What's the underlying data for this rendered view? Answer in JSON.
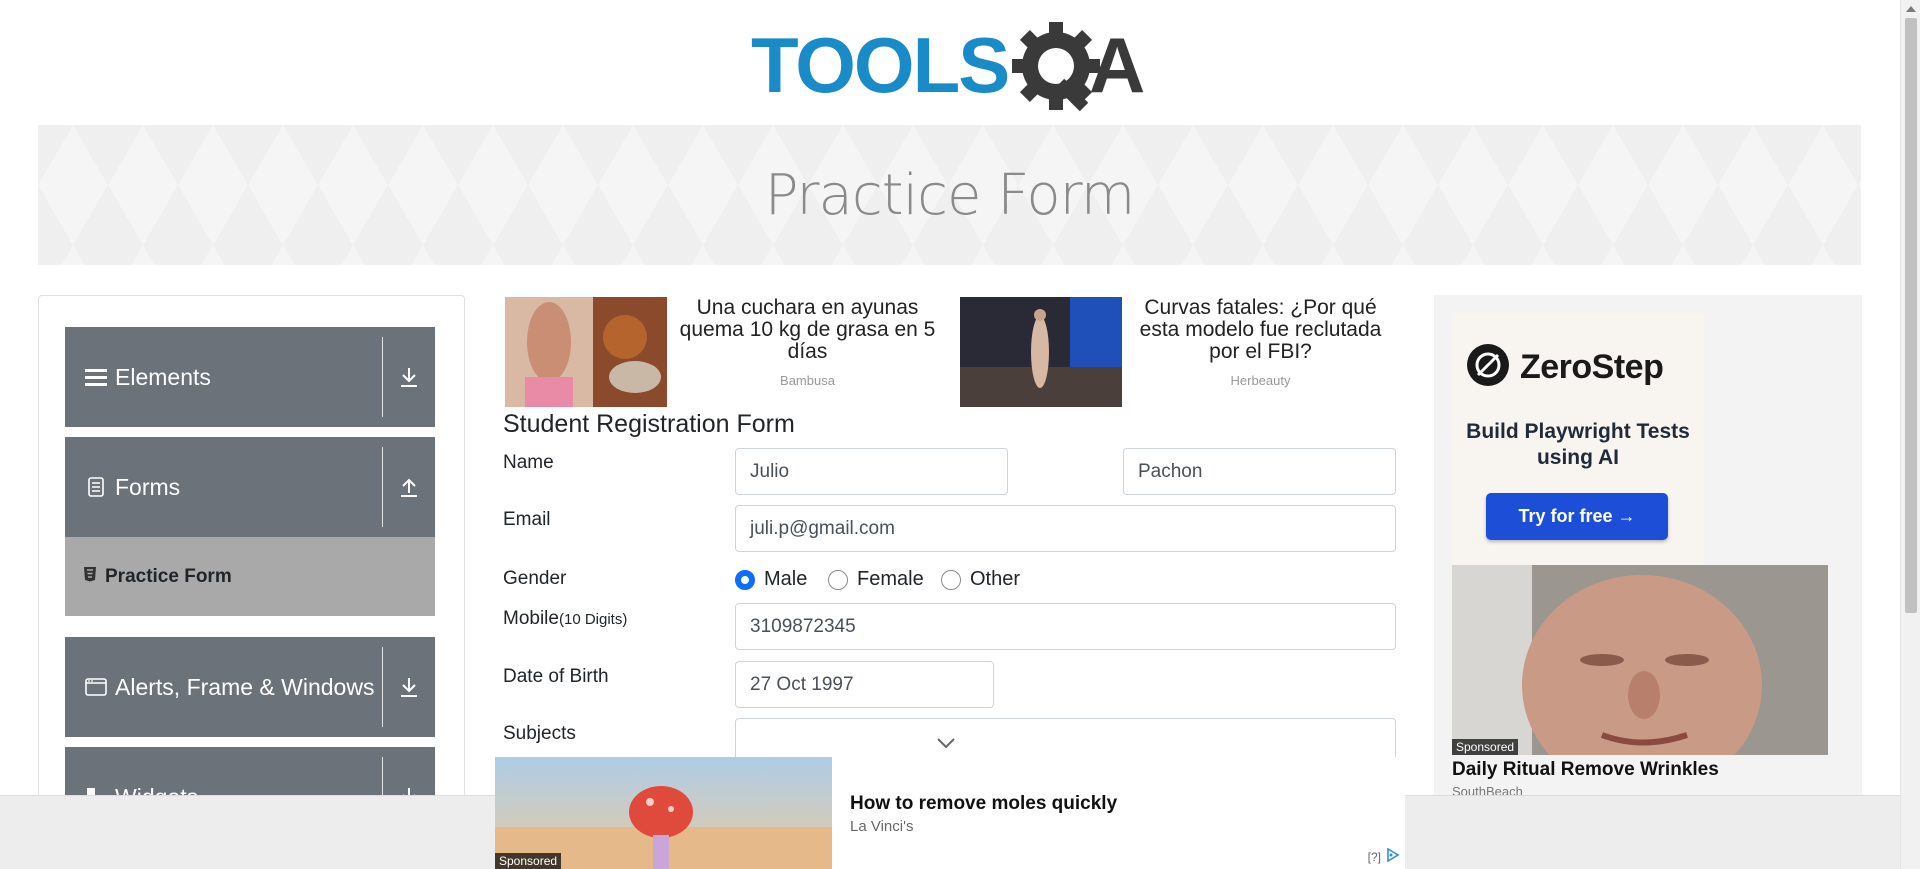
{
  "header": {
    "logo_alt": "TOOLSQA",
    "logo_text_left": "TOOLS",
    "logo_text_right": "A",
    "logo_blue": "#1a8bc9",
    "logo_dark": "#3a3a3a"
  },
  "banner": {
    "title": "Practice Form"
  },
  "sidebar": {
    "groups": [
      {
        "label": "Elements",
        "icon": "menu-icon",
        "state": "collapsed"
      },
      {
        "label": "Forms",
        "icon": "document-icon",
        "state": "expanded"
      },
      {
        "label": "Alerts, Frame & Windows",
        "icon": "window-icon",
        "state": "collapsed"
      },
      {
        "label": "Widgets",
        "icon": "widgets-icon",
        "state": "collapsed"
      }
    ],
    "active_item": {
      "label": "Practice Form",
      "icon": "form-icon"
    },
    "group_color": "#6b727a",
    "active_color": "#a9a9a9"
  },
  "ads": {
    "top_left": {
      "text": "Una cuchara en ayunas quema 10 kg de grasa en 5 días",
      "source": "Bambusa"
    },
    "top_right": {
      "text": "Curvas fatales: ¿Por qué esta modelo fue reclutada por el FBI?",
      "source": "Herbeauty"
    },
    "right": {
      "brand": "ZeroStep",
      "headline": "Build Playwright Tests using AI",
      "cta": "Try for free →",
      "sponsored": "Sponsored",
      "title": "Daily Ritual Remove Wrinkles",
      "source": "SouthBeach"
    },
    "bottom": {
      "sponsored": "Sponsored",
      "title": "How to remove moles quickly",
      "source": "La Vinci's",
      "info": "[?]"
    }
  },
  "form": {
    "title": "Student Registration Form",
    "name_label": "Name",
    "first_name": "Julio",
    "last_name": "Pachon",
    "email_label": "Email",
    "email": "juli.p@gmail.com",
    "gender_label": "Gender",
    "gender_options": [
      "Male",
      "Female",
      "Other"
    ],
    "gender_selected": "Male",
    "mobile_label": "Mobile",
    "mobile_hint": "(10 Digits)",
    "mobile": "3109872345",
    "dob_label": "Date of Birth",
    "dob": "27 Oct 1997",
    "subjects_label": "Subjects",
    "accent": "#0d6efd"
  }
}
